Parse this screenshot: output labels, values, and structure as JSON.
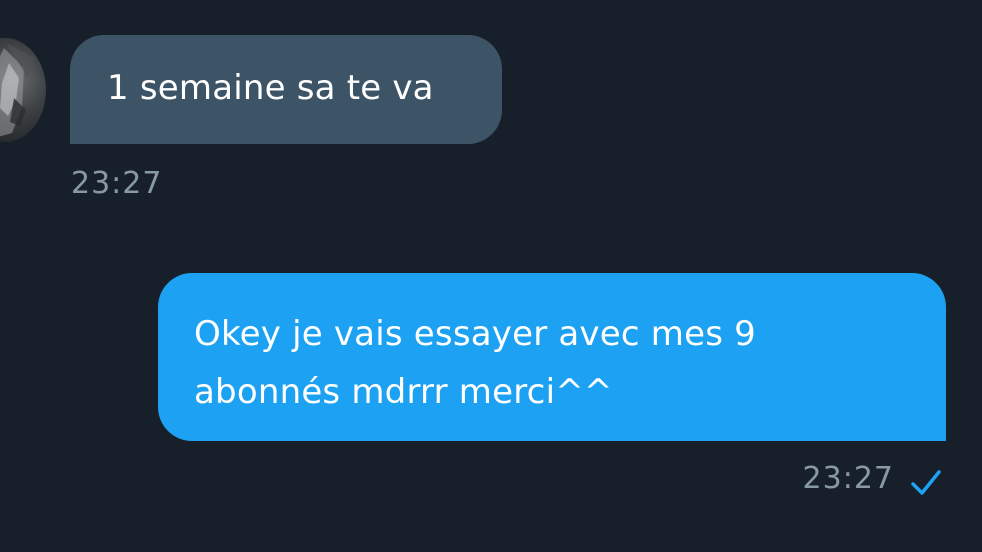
{
  "conversation": {
    "messages": [
      {
        "direction": "incoming",
        "text": "1 semaine sa te va",
        "time": "23:27"
      },
      {
        "direction": "outgoing",
        "text": "Okey je vais essayer avec mes 9 abonnés mdrrr merci^^",
        "time": "23:27",
        "status_icon": "checkmark-icon"
      }
    ]
  },
  "colors": {
    "background": "#17202a",
    "incoming_bubble": "#3d5466",
    "outgoing_bubble": "#1da1f2",
    "timestamp": "#8899a6",
    "check": "#1da1f2"
  }
}
